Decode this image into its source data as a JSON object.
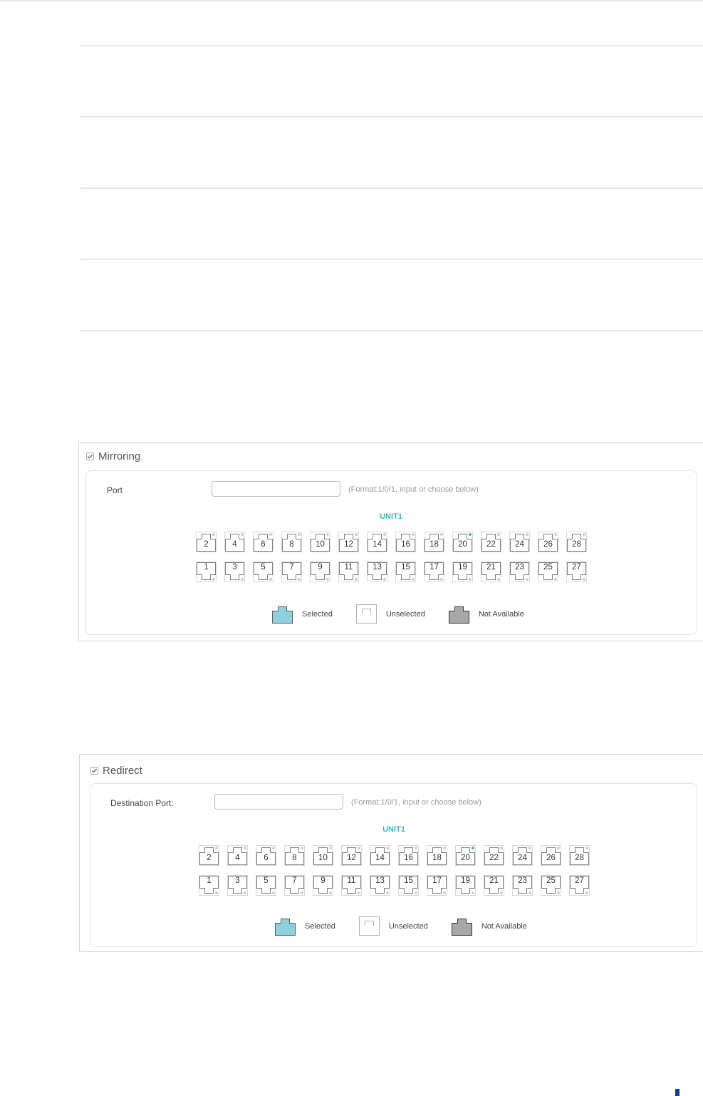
{
  "mirroring": {
    "title": "Mirroring",
    "checked": true,
    "field_label": "Port",
    "input_value": "",
    "input_placeholder": "",
    "hint": "(Format:1/0/1, input or choose below)",
    "unit_label": "UNIT1",
    "ports_top": [
      "2",
      "4",
      "6",
      "8",
      "10",
      "12",
      "14",
      "16",
      "18",
      "20",
      "22",
      "24",
      "26",
      "28"
    ],
    "ports_bottom": [
      "1",
      "3",
      "5",
      "7",
      "9",
      "11",
      "13",
      "15",
      "17",
      "19",
      "21",
      "23",
      "25",
      "27"
    ],
    "active_led_port": "20",
    "legend": {
      "selected": "Selected",
      "unselected": "Unselected",
      "not_available": "Not Available"
    }
  },
  "redirect": {
    "title": "Redirect",
    "checked": true,
    "field_label": "Destination Port:",
    "input_value": "",
    "input_placeholder": "",
    "hint": "(Format:1/0/1, input or choose below)",
    "unit_label": "UNIT1",
    "ports_top": [
      "2",
      "4",
      "6",
      "8",
      "10",
      "12",
      "14",
      "16",
      "18",
      "20",
      "22",
      "24",
      "26",
      "28"
    ],
    "ports_bottom": [
      "1",
      "3",
      "5",
      "7",
      "9",
      "11",
      "13",
      "15",
      "17",
      "19",
      "21",
      "23",
      "25",
      "27"
    ],
    "active_led_port": "20",
    "legend": {
      "selected": "Selected",
      "unselected": "Unselected",
      "not_available": "Not Available"
    }
  },
  "colors": {
    "accent": "#3cb6c0",
    "selected_fill": "#8ed1dc",
    "not_available_fill": "#a8a8a8",
    "port_outline": "#a3a3a3"
  }
}
